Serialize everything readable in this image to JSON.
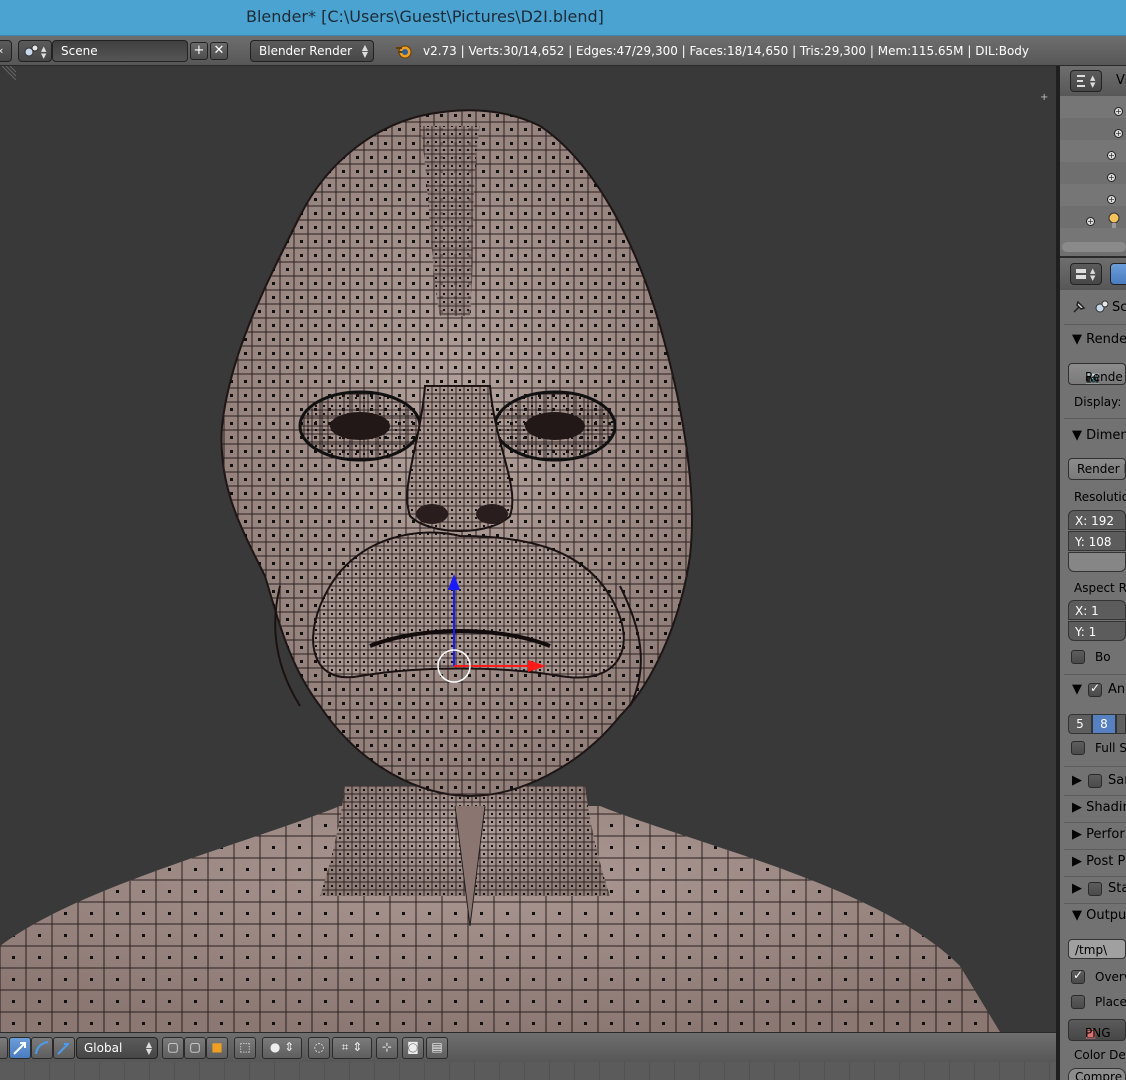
{
  "window": {
    "title": "Blender* [C:\\Users\\Guest\\Pictures\\D2I.blend]"
  },
  "info_header": {
    "scene_name": "Scene",
    "render_engine": "Blender Render",
    "stats": "v2.73 | Verts:30/14,652 | Edges:47/29,300 | Faces:18/14,650 | Tris:29,300 | Mem:115.65M | DIL:Body"
  },
  "outliner": {
    "view_label": "Vi"
  },
  "properties": {
    "scene_label": "Sc",
    "render_panel": "Rende",
    "render_button": "Rende",
    "display_label": "Display:",
    "dimensions_panel": "Dimen",
    "render_presets": "Render P",
    "resolution_label": "Resolutio",
    "res_x": "X:  192",
    "res_y": "Y:  108",
    "aspect_label": "Aspect Ra",
    "aspect_x": "X:     1",
    "aspect_y": "Y:     1",
    "border_label": "Bo",
    "antialias_panel": "An",
    "aa_5": "5",
    "aa_8": "8",
    "full_sample": "Full S",
    "sampled_panel": "Sar",
    "shading_panel": "Shadin",
    "performance_panel": "Perfor",
    "post_processing_panel": "Post Pr",
    "stamp_panel": "Sta",
    "output_panel": "Output",
    "output_path": "/tmp\\",
    "overwrite": "Overv",
    "placeholders": "Place",
    "file_format": "PNG",
    "color_depth": "Color Dep",
    "compression": "Compre"
  },
  "view3d_header": {
    "orientation": "Global"
  },
  "colors": {
    "title_bar": "#4ba3d1",
    "viewport_bg": "#393939",
    "mesh_fill": "#9b8782",
    "axis_x": "#e01010",
    "axis_z": "#1010e0"
  }
}
